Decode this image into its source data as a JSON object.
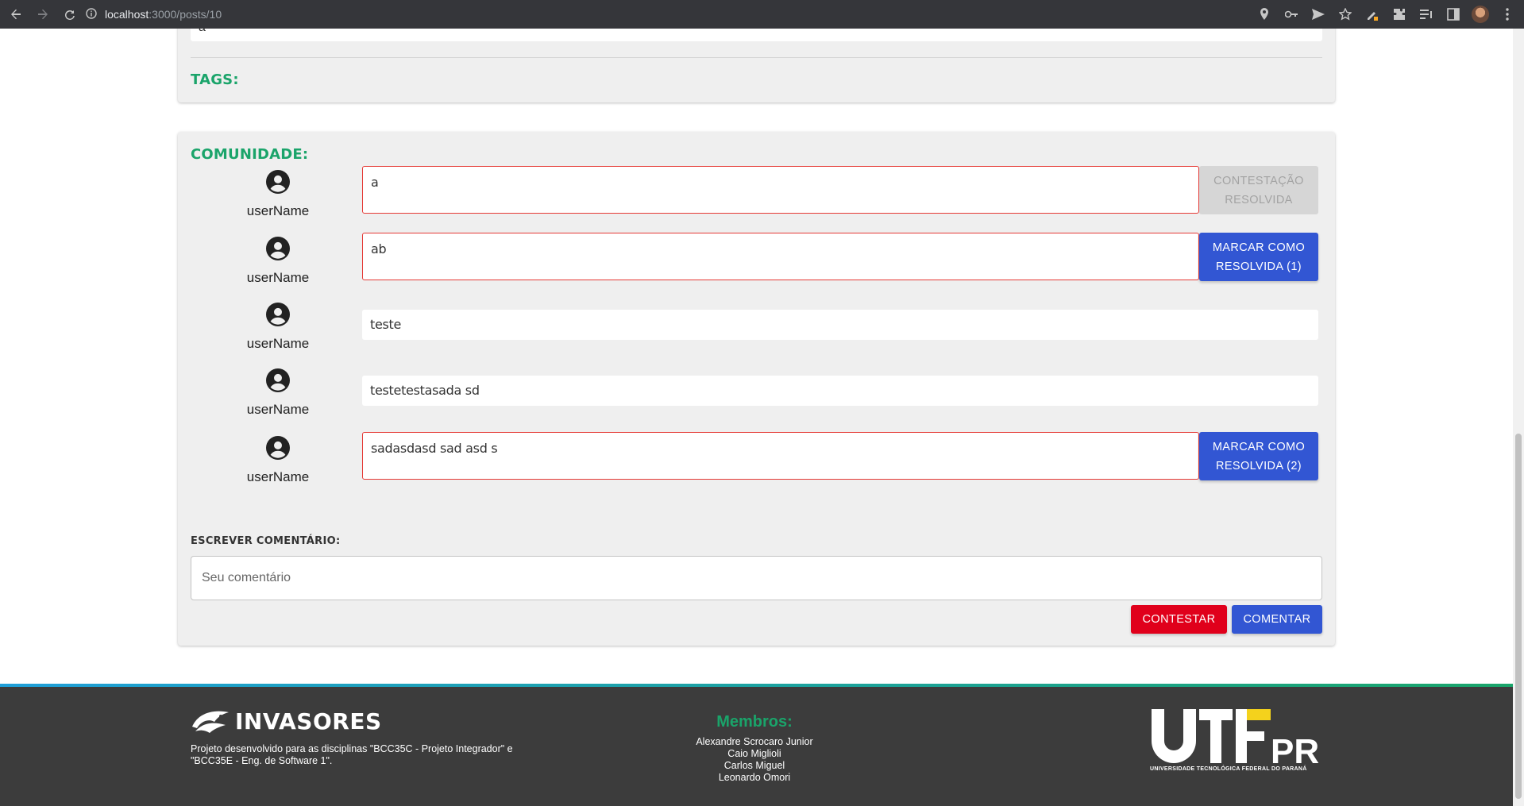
{
  "browser": {
    "url_host": "localhost",
    "url_path": ":3000/posts/10"
  },
  "post": {
    "previous_field_value": "a",
    "tags_label": "TAGS:"
  },
  "community": {
    "title": "COMUNIDADE:",
    "comments": [
      {
        "user": "userName",
        "text": "a",
        "flagged": true,
        "button": "CONTESTAÇÃO RESOLVIDA",
        "button_state": "disabled"
      },
      {
        "user": "userName",
        "text": "ab",
        "flagged": true,
        "button": "MARCAR COMO RESOLVIDA (1)",
        "button_state": "active"
      },
      {
        "user": "userName",
        "text": "teste",
        "flagged": false
      },
      {
        "user": "userName",
        "text": "testetestasada sd",
        "flagged": false
      },
      {
        "user": "userName",
        "text": "sadasdasd sad asd s",
        "flagged": true,
        "button": "MARCAR COMO RESOLVIDA (2)",
        "button_state": "active"
      }
    ],
    "write_label": "ESCREVER COMENTÁRIO:",
    "input_placeholder": "Seu comentário",
    "contest_button": "CONTESTAR",
    "comment_button": "COMENTAR"
  },
  "footer": {
    "brand": "INVASORES",
    "description": "Projeto desenvolvido para as disciplinas \"BCC35C - Projeto Integrador\" e \"BCC35E - Eng. de Software 1\".",
    "members_title": "Membros:",
    "members": [
      "Alexandre Scrocaro Junior",
      "Caio Miglioli",
      "Carlos Miguel",
      "Leonardo Omori"
    ],
    "university_logo_text": "UTFPR",
    "university_name": "UNIVERSIDADE TECNOLÓGICA FEDERAL DO PARANÁ"
  },
  "colors": {
    "accent_green": "#1aa46a",
    "button_blue": "#3256d3",
    "button_red": "#e0001b",
    "flag_border": "#e53935"
  }
}
